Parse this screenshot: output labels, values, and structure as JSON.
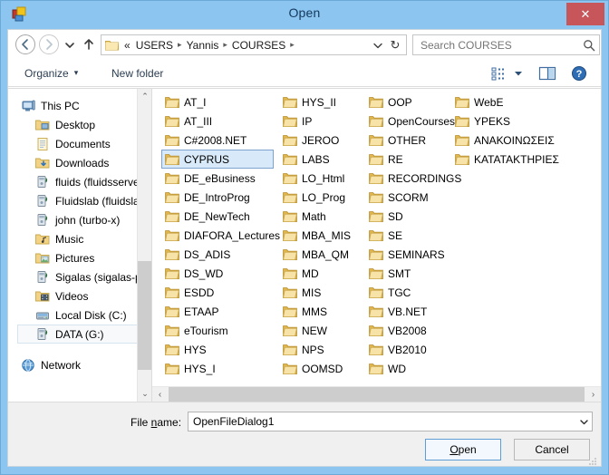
{
  "window": {
    "title": "Open",
    "app_icon": "visual-studio-dialog-icon",
    "close_label": "✕",
    "frame_color": "#8cc6f0",
    "close_button_color": "#c7565b"
  },
  "address": {
    "back_icon": "back-arrow-icon",
    "forward_icon": "forward-arrow-icon",
    "recent_icon": "chevron-down-icon",
    "up_icon": "up-arrow-icon",
    "folder_icon": "folder-icon",
    "root_chevrons": "«",
    "crumbs": [
      "USERS",
      "Yannis",
      "COURSES"
    ],
    "separator": "▸",
    "dropdown_icon": "chevron-down-icon",
    "refresh_icon": "refresh-icon",
    "refresh_glyph": "↻"
  },
  "search": {
    "placeholder": "Search COURSES",
    "value": "",
    "icon": "search-icon"
  },
  "toolbar": {
    "organize_label": "Organize",
    "organize_arrow": "▾",
    "new_folder_label": "New folder",
    "viewmode_icon": "view-options-icon",
    "viewmode_arrow": "▾",
    "pane_icon": "preview-pane-icon",
    "help_icon": "help-icon"
  },
  "navpane": {
    "items": [
      {
        "label": "This PC",
        "icon": "computer-icon",
        "level": "root",
        "selected": false
      },
      {
        "label": "Desktop",
        "icon": "desktop-icon",
        "level": "indent",
        "selected": false
      },
      {
        "label": "Documents",
        "icon": "documents-icon",
        "level": "indent",
        "selected": false
      },
      {
        "label": "Downloads",
        "icon": "downloads-icon",
        "level": "indent",
        "selected": false
      },
      {
        "label": "fluids (fluidsserve",
        "icon": "network-drive-icon",
        "level": "indent",
        "selected": false
      },
      {
        "label": "Fluidslab (fluidsla",
        "icon": "network-drive-icon",
        "level": "indent",
        "selected": false
      },
      {
        "label": "john (turbo-x)",
        "icon": "network-drive-icon",
        "level": "indent",
        "selected": false
      },
      {
        "label": "Music",
        "icon": "music-icon",
        "level": "indent",
        "selected": false
      },
      {
        "label": "Pictures",
        "icon": "pictures-icon",
        "level": "indent",
        "selected": false
      },
      {
        "label": "Sigalas (sigalas-p",
        "icon": "network-drive-icon",
        "level": "indent",
        "selected": false
      },
      {
        "label": "Videos",
        "icon": "videos-icon",
        "level": "indent",
        "selected": false
      },
      {
        "label": "Local Disk (C:)",
        "icon": "hard-drive-icon",
        "level": "indent",
        "selected": false
      },
      {
        "label": "DATA (G:)",
        "icon": "network-drive-icon",
        "level": "indent",
        "selected": true
      }
    ],
    "network_label": "Network",
    "network_icon": "network-icon",
    "scrollbar": {
      "up_glyph": "⌃",
      "down_glyph": "⌄"
    }
  },
  "filelist": {
    "columns": [
      {
        "wide": true,
        "items": [
          {
            "label": "AT_I",
            "selected": false
          },
          {
            "label": "AT_III",
            "selected": false
          },
          {
            "label": "C#2008.NET",
            "selected": false
          },
          {
            "label": "CYPRUS",
            "selected": true
          },
          {
            "label": "DE_eBusiness",
            "selected": false
          },
          {
            "label": "DE_IntroProg",
            "selected": false
          },
          {
            "label": "DE_NewTech",
            "selected": false
          },
          {
            "label": "DIAFORA_Lectures",
            "selected": false
          },
          {
            "label": "DS_ADIS",
            "selected": false
          },
          {
            "label": "DS_WD",
            "selected": false
          },
          {
            "label": "ESDD",
            "selected": false
          },
          {
            "label": "ETAAP",
            "selected": false
          },
          {
            "label": "eTourism",
            "selected": false
          },
          {
            "label": "HYS",
            "selected": false
          },
          {
            "label": "HYS_I",
            "selected": false
          }
        ]
      },
      {
        "wide": false,
        "items": [
          {
            "label": "HYS_II",
            "selected": false
          },
          {
            "label": "IP",
            "selected": false
          },
          {
            "label": "JEROO",
            "selected": false
          },
          {
            "label": "LABS",
            "selected": false
          },
          {
            "label": "LO_Html",
            "selected": false
          },
          {
            "label": "LO_Prog",
            "selected": false
          },
          {
            "label": "Math",
            "selected": false
          },
          {
            "label": "MBA_MIS",
            "selected": false
          },
          {
            "label": "MBA_QM",
            "selected": false
          },
          {
            "label": "MD",
            "selected": false
          },
          {
            "label": "MIS",
            "selected": false
          },
          {
            "label": "MMS",
            "selected": false
          },
          {
            "label": "NEW",
            "selected": false
          },
          {
            "label": "NPS",
            "selected": false
          },
          {
            "label": "OOMSD",
            "selected": false
          }
        ]
      },
      {
        "wide": false,
        "items": [
          {
            "label": "OOP",
            "selected": false
          },
          {
            "label": "OpenCourses",
            "selected": false
          },
          {
            "label": "OTHER",
            "selected": false
          },
          {
            "label": "RE",
            "selected": false
          },
          {
            "label": "RECORDINGS",
            "selected": false
          },
          {
            "label": "SCORM",
            "selected": false
          },
          {
            "label": "SD",
            "selected": false
          },
          {
            "label": "SE",
            "selected": false
          },
          {
            "label": "SEMINARS",
            "selected": false
          },
          {
            "label": "SMT",
            "selected": false
          },
          {
            "label": "TGC",
            "selected": false
          },
          {
            "label": "VB.NET",
            "selected": false
          },
          {
            "label": "VB2008",
            "selected": false
          },
          {
            "label": "VB2010",
            "selected": false
          },
          {
            "label": "WD",
            "selected": false
          }
        ]
      },
      {
        "wide": true,
        "items": [
          {
            "label": "WebE",
            "selected": false
          },
          {
            "label": "YPEKS",
            "selected": false
          },
          {
            "label": "ΑΝΑΚΟΙΝΩΣΕΙΣ",
            "selected": false
          },
          {
            "label": "ΚΑΤΑΤΑΚΤΗΡΙΕΣ",
            "selected": false
          }
        ]
      }
    ],
    "hscroll": {
      "left_glyph": "‹",
      "right_glyph": "›"
    }
  },
  "footer": {
    "filename_label_pre": "File ",
    "filename_label_accel": "n",
    "filename_label_post": "ame:",
    "filename_value": "OpenFileDialog1",
    "filename_placeholder": "",
    "filename_arrow": "⌄",
    "open_pre": "",
    "open_accel": "O",
    "open_post": "pen",
    "cancel_label": "Cancel",
    "grip_icon": "resize-grip-icon"
  }
}
